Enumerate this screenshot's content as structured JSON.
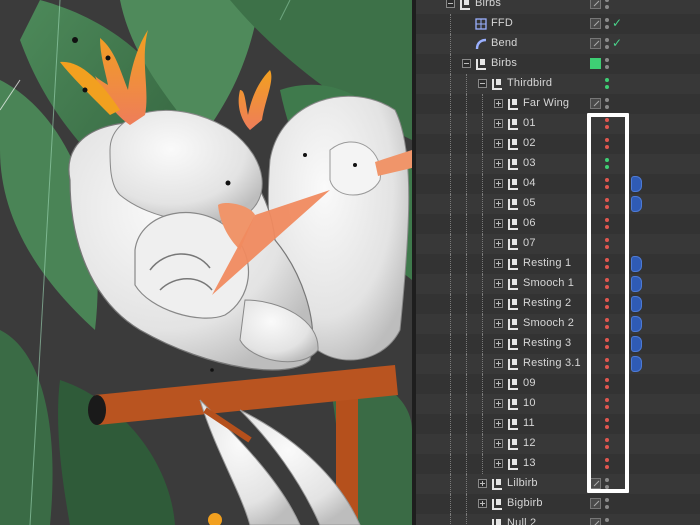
{
  "colors": {
    "bg_scene": "#3b3b3b",
    "leaf_dark": "#3f6b46",
    "leaf_light": "#4f8a5b",
    "bird_white": "#ececec",
    "beak_orange": "#f0956a",
    "crest_orange": "#f59a3a",
    "perch_brown": "#b5501c",
    "dot_red": "#e0574f",
    "dot_green": "#3ecf74",
    "dot_gray": "#8a8a8a",
    "tag_blue": "#2f5bb5",
    "highlight": "#ffffff"
  },
  "object_manager": {
    "rows": [
      {
        "label": "Birbs",
        "indent": 0,
        "icon": "null-object-icon",
        "expander": "minus",
        "layer": "gray",
        "dots": [
          "gray",
          "gray"
        ],
        "check": false,
        "tag": false
      },
      {
        "label": "FFD",
        "indent": 1,
        "icon": "ffd-deformer-icon",
        "expander": "none",
        "layer": "gray",
        "dots": [
          "gray",
          "gray"
        ],
        "check": true,
        "tag": false
      },
      {
        "label": "Bend",
        "indent": 1,
        "icon": "bend-deformer-icon",
        "expander": "none",
        "layer": "gray",
        "dots": [
          "gray",
          "gray"
        ],
        "check": true,
        "tag": false
      },
      {
        "label": "Birbs",
        "indent": 1,
        "icon": "null-object-icon",
        "expander": "minus",
        "layer": "green",
        "dots": [
          "gray",
          "gray"
        ],
        "check": false,
        "tag": false
      },
      {
        "label": "Thirdbird",
        "indent": 2,
        "icon": "null-object-icon",
        "expander": "minus",
        "layer": "none",
        "dots": [
          "green",
          "green"
        ],
        "check": false,
        "tag": false
      },
      {
        "label": "Far Wing",
        "indent": 3,
        "icon": "null-object-icon",
        "expander": "plus",
        "layer": "gray",
        "dots": [
          "gray",
          "gray"
        ],
        "check": false,
        "tag": false
      },
      {
        "label": "01",
        "indent": 3,
        "icon": "null-object-icon",
        "expander": "plus",
        "layer": "none",
        "dots": [
          "red",
          "red"
        ],
        "check": false,
        "tag": false
      },
      {
        "label": "02",
        "indent": 3,
        "icon": "null-object-icon",
        "expander": "plus",
        "layer": "none",
        "dots": [
          "red",
          "red"
        ],
        "check": false,
        "tag": false
      },
      {
        "label": "03",
        "indent": 3,
        "icon": "null-object-icon",
        "expander": "plus",
        "layer": "none",
        "dots": [
          "green",
          "green"
        ],
        "check": false,
        "tag": false
      },
      {
        "label": "04",
        "indent": 3,
        "icon": "null-object-icon",
        "expander": "plus",
        "layer": "none",
        "dots": [
          "red",
          "red"
        ],
        "check": false,
        "tag": true
      },
      {
        "label": "05",
        "indent": 3,
        "icon": "null-object-icon",
        "expander": "plus",
        "layer": "none",
        "dots": [
          "red",
          "red"
        ],
        "check": false,
        "tag": true
      },
      {
        "label": "06",
        "indent": 3,
        "icon": "null-object-icon",
        "expander": "plus",
        "layer": "none",
        "dots": [
          "red",
          "red"
        ],
        "check": false,
        "tag": false
      },
      {
        "label": "07",
        "indent": 3,
        "icon": "null-object-icon",
        "expander": "plus",
        "layer": "none",
        "dots": [
          "red",
          "red"
        ],
        "check": false,
        "tag": false
      },
      {
        "label": "Resting 1",
        "indent": 3,
        "icon": "null-object-icon",
        "expander": "plus",
        "layer": "none",
        "dots": [
          "red",
          "red"
        ],
        "check": false,
        "tag": true
      },
      {
        "label": "Smooch 1",
        "indent": 3,
        "icon": "null-object-icon",
        "expander": "plus",
        "layer": "none",
        "dots": [
          "red",
          "red"
        ],
        "check": false,
        "tag": true
      },
      {
        "label": "Resting 2",
        "indent": 3,
        "icon": "null-object-icon",
        "expander": "plus",
        "layer": "none",
        "dots": [
          "red",
          "red"
        ],
        "check": false,
        "tag": true
      },
      {
        "label": "Smooch 2",
        "indent": 3,
        "icon": "null-object-icon",
        "expander": "plus",
        "layer": "none",
        "dots": [
          "red",
          "red"
        ],
        "check": false,
        "tag": true
      },
      {
        "label": "Resting 3",
        "indent": 3,
        "icon": "null-object-icon",
        "expander": "plus",
        "layer": "none",
        "dots": [
          "red",
          "red"
        ],
        "check": false,
        "tag": true
      },
      {
        "label": "Resting 3.1",
        "indent": 3,
        "icon": "null-object-icon",
        "expander": "plus",
        "layer": "none",
        "dots": [
          "red",
          "red"
        ],
        "check": false,
        "tag": true
      },
      {
        "label": "09",
        "indent": 3,
        "icon": "null-object-icon",
        "expander": "plus",
        "layer": "none",
        "dots": [
          "red",
          "red"
        ],
        "check": false,
        "tag": false
      },
      {
        "label": "10",
        "indent": 3,
        "icon": "null-object-icon",
        "expander": "plus",
        "layer": "none",
        "dots": [
          "red",
          "red"
        ],
        "check": false,
        "tag": false
      },
      {
        "label": "11",
        "indent": 3,
        "icon": "null-object-icon",
        "expander": "plus",
        "layer": "none",
        "dots": [
          "red",
          "red"
        ],
        "check": false,
        "tag": false
      },
      {
        "label": "12",
        "indent": 3,
        "icon": "null-object-icon",
        "expander": "plus",
        "layer": "none",
        "dots": [
          "red",
          "red"
        ],
        "check": false,
        "tag": false
      },
      {
        "label": "13",
        "indent": 3,
        "icon": "null-object-icon",
        "expander": "plus",
        "layer": "none",
        "dots": [
          "red",
          "red"
        ],
        "check": false,
        "tag": false
      },
      {
        "label": "Lilbirb",
        "indent": 2,
        "icon": "null-object-icon",
        "expander": "plus",
        "layer": "gray",
        "dots": [
          "gray",
          "gray"
        ],
        "check": false,
        "tag": false
      },
      {
        "label": "Bigbirb",
        "indent": 2,
        "icon": "null-object-icon",
        "expander": "plus",
        "layer": "gray",
        "dots": [
          "gray",
          "gray"
        ],
        "check": false,
        "tag": false
      },
      {
        "label": "Null 2",
        "indent": 2,
        "icon": "null-object-icon",
        "expander": "none",
        "layer": "gray",
        "dots": [
          "gray",
          "gray"
        ],
        "check": false,
        "tag": false
      }
    ]
  }
}
